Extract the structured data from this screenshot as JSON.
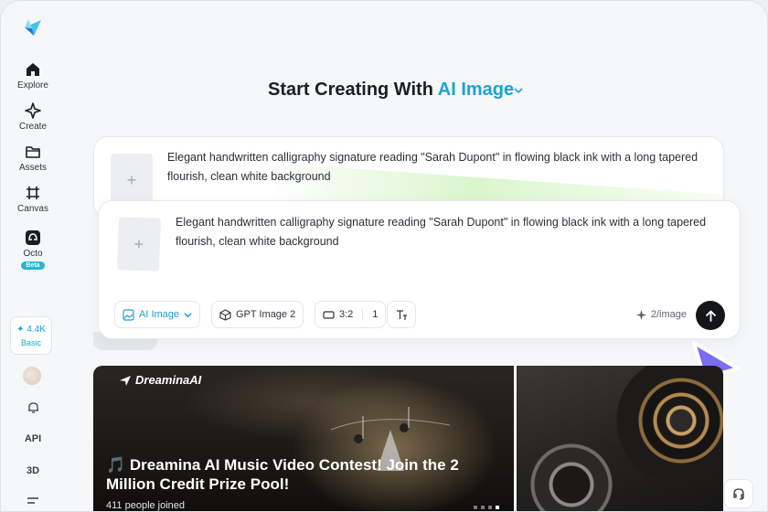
{
  "sidebar": {
    "items": [
      {
        "label": "Explore",
        "icon": "home-icon"
      },
      {
        "label": "Create",
        "icon": "sparkle-icon"
      },
      {
        "label": "Assets",
        "icon": "folder-icon"
      },
      {
        "label": "Canvas",
        "icon": "canvas-icon"
      },
      {
        "label": "Octo",
        "icon": "octo-icon",
        "badge": "Beta"
      }
    ],
    "credits": {
      "amount": "4.4K",
      "plan": "Basic"
    },
    "bottom": {
      "api": "API",
      "three_d": "3D"
    }
  },
  "main": {
    "title_prefix": "Start Creating With",
    "title_mode": "AI Image",
    "prompt_back": "Elegant handwritten calligraphy signature reading \"Sarah Dupont\" in flowing black ink with a long tapered flourish, clean white background",
    "prompt_front": "Elegant handwritten calligraphy signature reading \"Sarah Dupont\" in flowing black ink with a long tapered flourish, clean white background",
    "toolbar": {
      "mode": "AI Image",
      "model": "GPT Image 2",
      "ratio": "3:2",
      "count": "1",
      "cost": "2/image"
    }
  },
  "banner": {
    "brand": "DreaminaAI",
    "title": "🎵 Dreamina AI Music Video Contest! Join the 2 Million Credit Prize Pool!",
    "subtitle": "411  people joined"
  },
  "colors": {
    "accent": "#1da3d0",
    "cursor": "#7b6cf6"
  }
}
